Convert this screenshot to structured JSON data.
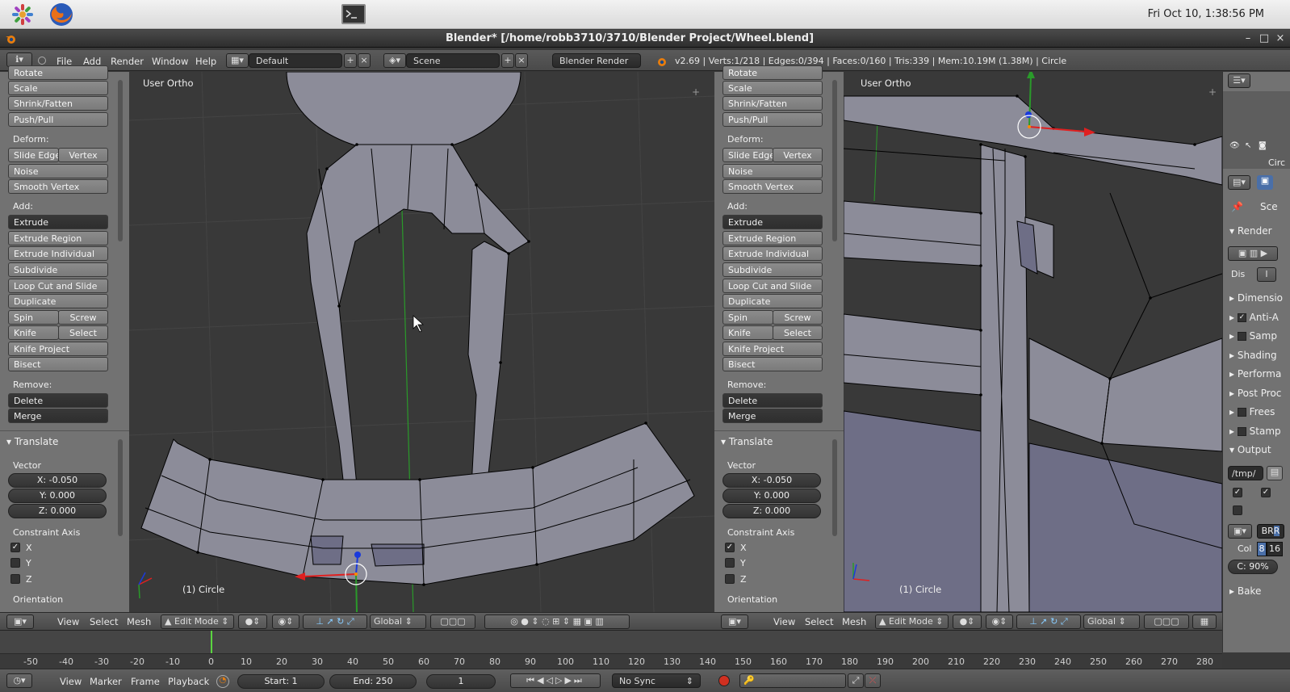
{
  "system": {
    "clock": "Fri Oct 10,  1:38:56 PM",
    "launcher_icon": "apps-icon",
    "browser_icon": "firefox-icon",
    "terminal_icon": "terminal-icon"
  },
  "window": {
    "title": "Blender* [/home/robb3710/3710/Blender Project/Wheel.blend]",
    "controls": [
      "–",
      "□",
      "×"
    ]
  },
  "infobar": {
    "menus": [
      "File",
      "Add",
      "Render",
      "Window",
      "Help"
    ],
    "layout": "Default",
    "scene": "Scene",
    "engine": "Blender Render",
    "stats": "v2.69 | Verts:1/218 | Edges:0/394 | Faces:0/160 | Tris:339 | Mem:10.19M (1.38M) | Circle"
  },
  "toolshelf": {
    "top_items": [
      "Rotate",
      "Scale",
      "Shrink/Fatten",
      "Push/Pull"
    ],
    "deform_label": "Deform:",
    "slide_edge": "Slide Edge",
    "vertex": "Vertex",
    "noise": "Noise",
    "smooth_vertex": "Smooth Vertex",
    "add_label": "Add:",
    "extrude": "Extrude",
    "extrude_region": "Extrude Region",
    "extrude_individual": "Extrude Individual",
    "subdivide": "Subdivide",
    "loop_cut": "Loop Cut and Slide",
    "duplicate": "Duplicate",
    "spin": "Spin",
    "screw": "Screw",
    "knife": "Knife",
    "select": "Select",
    "knife_project": "Knife Project",
    "bisect": "Bisect",
    "remove_label": "Remove:",
    "delete": "Delete",
    "merge": "Merge",
    "operator_title": "Translate",
    "vector_label": "Vector",
    "x": "X: -0.050",
    "y": "Y: 0.000",
    "z": "Z: 0.000",
    "constraint_label": "Constraint Axis",
    "axis_x": "X",
    "axis_y": "Y",
    "axis_z": "Z",
    "orientation_label": "Orientation"
  },
  "viewport": {
    "view_name": "User Ortho",
    "object_label": "(1) Circle"
  },
  "view_header": {
    "menus": [
      "View",
      "Select",
      "Mesh"
    ],
    "mode": "Edit Mode",
    "orientation": "Global"
  },
  "properties": {
    "scene_label": "Sce",
    "render_label": "Render",
    "display_label": "Dis",
    "display_value": "I",
    "sections": [
      "Dimensio",
      "Anti-A",
      "Samp",
      "Shading",
      "Performa",
      "Post Proc",
      "Frees",
      "Stamp",
      "Output"
    ],
    "output_path": "/tmp/",
    "format_br": "BR",
    "format_r": "R",
    "color_label": "Col",
    "color_depth_8": "8",
    "color_depth_16": "16",
    "compression": "C: 90%",
    "bake": "Bake",
    "circle": "Circ"
  },
  "timeline": {
    "ticks": [
      "-50",
      "-40",
      "-30",
      "-20",
      "-10",
      "0",
      "10",
      "20",
      "30",
      "40",
      "50",
      "60",
      "70",
      "80",
      "90",
      "100",
      "110",
      "120",
      "130",
      "140",
      "150",
      "160",
      "170",
      "180",
      "190",
      "200",
      "210",
      "220",
      "230",
      "240",
      "250",
      "260",
      "270",
      "280"
    ],
    "menus": [
      "View",
      "Marker",
      "Frame",
      "Playback"
    ],
    "start": "Start: 1",
    "end": "End: 250",
    "current": "1",
    "sync": "No Sync"
  },
  "colors": {
    "mesh_face": "#8c8c99",
    "mesh_edge": "#000000",
    "y_axis": "#2a9a2a",
    "x_axis": "#e02020",
    "z_axis": "#1a3adc"
  }
}
